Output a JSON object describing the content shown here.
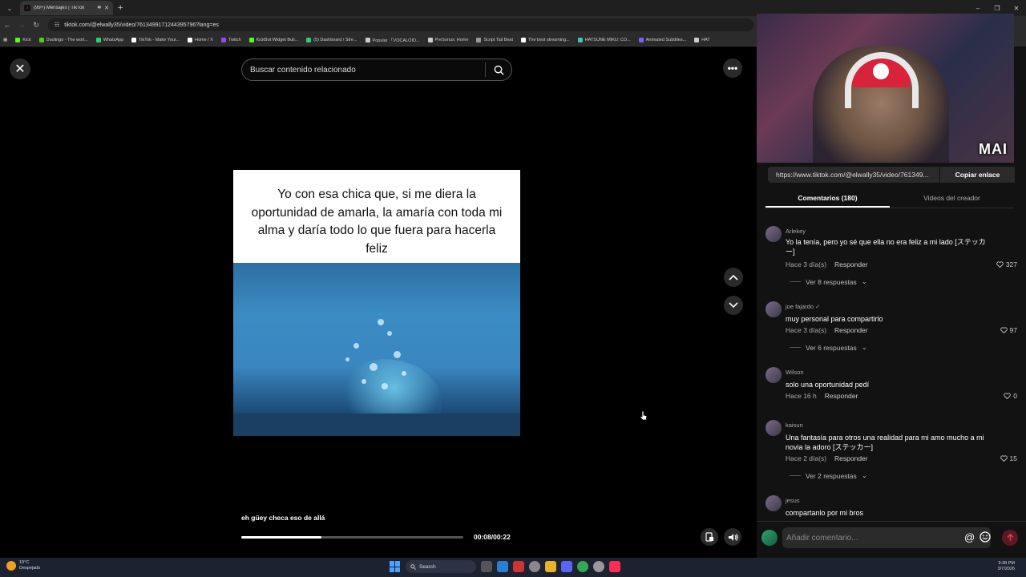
{
  "browser": {
    "tab_title": "(99+) Mensajes | TikTok",
    "url": "tiktok.com/@elwally35/video/7613499171244395796?lang=es",
    "bookmarks": [
      {
        "label": "Kick",
        "color": "#53fc18"
      },
      {
        "label": "Duolingo - The worl...",
        "color": "#58cc02"
      },
      {
        "label": "WhatsApp",
        "color": "#25d366"
      },
      {
        "label": "TikTok - Make Your...",
        "color": "#ffffff"
      },
      {
        "label": "Home / X",
        "color": "#ffffff"
      },
      {
        "label": "Twitch",
        "color": "#9146ff"
      },
      {
        "label": "KickBot Widget Buil...",
        "color": "#53fc18"
      },
      {
        "label": "(5) Dashboard / Stre...",
        "color": "#2ecc71"
      },
      {
        "label": "Popular 「VOCALOID...",
        "color": "#cccccc"
      },
      {
        "label": "PreSonus: Home",
        "color": "#cccccc"
      },
      {
        "label": "Script Tail Beat",
        "color": "#999999"
      },
      {
        "label": "The best streaming...",
        "color": "#ffffff"
      },
      {
        "label": "HATSUNE MIKU: CO...",
        "color": "#39c5bb"
      },
      {
        "label": "Animated Subtitles...",
        "color": "#7a5cff"
      },
      {
        "label": "HAT",
        "color": "#cccccc"
      }
    ]
  },
  "video": {
    "search_placeholder": "Buscar contenido relacionado",
    "overlay_text": "Yo con esa chica que, si me diera la oportunidad de amarla, la amaría con toda mi alma y daría todo lo que fuera para hacerla feliz",
    "subtitle": "eh güey checa eso de allá",
    "time": "00:08/00:22",
    "progress": 0.36
  },
  "panel": {
    "webcam_brand": "MAI",
    "share_link": "https://www.tiktok.com/@elwally35/video/761349...",
    "copy_label": "Copiar enlace",
    "tabs": [
      "Comentarios (180)",
      "Videos del creador"
    ],
    "comments": [
      {
        "user": "Arlekey",
        "text": "Yo la tenía, pero yo sé que ella no era feliz a mi lado [ステッカー]",
        "time": "Hace 3 día(s)",
        "reply": "Responder",
        "likes": "327",
        "replies": "Ver 8 respuestas"
      },
      {
        "user": "joe fajardo ✓",
        "text": "muy personal para compartirlo",
        "time": "Hace 3 día(s)",
        "reply": "Responder",
        "likes": "97",
        "replies": "Ver 6 respuestas"
      },
      {
        "user": "Wilson",
        "text": "solo una oportunidad pedí",
        "time": "Hace 16 h",
        "reply": "Responder",
        "likes": "0",
        "replies": ""
      },
      {
        "user": "kaisun",
        "text": "Una fantasía para otros una realidad para mi amo mucho a mi novia la adoro [ステッカー]",
        "time": "Hace 2 día(s)",
        "reply": "Responder",
        "likes": "15",
        "replies": "Ver 2 respuestas"
      },
      {
        "user": "jesus",
        "text": "compartanlo por mi bros",
        "time": "",
        "reply": "",
        "likes": "",
        "replies": ""
      }
    ],
    "comment_placeholder": "Añadir comentario..."
  },
  "taskbar": {
    "temp": "19°C",
    "weather": "Despejado",
    "search": "Search",
    "time": "9:38 PM",
    "date": "3/7/2026"
  }
}
